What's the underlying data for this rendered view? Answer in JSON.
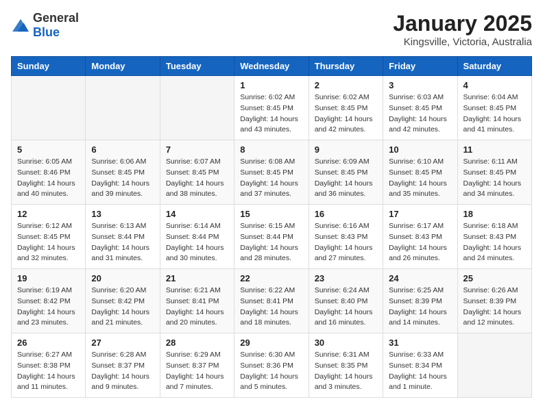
{
  "logo": {
    "general": "General",
    "blue": "Blue"
  },
  "title": "January 2025",
  "subtitle": "Kingsville, Victoria, Australia",
  "weekdays": [
    "Sunday",
    "Monday",
    "Tuesday",
    "Wednesday",
    "Thursday",
    "Friday",
    "Saturday"
  ],
  "weeks": [
    [
      {
        "day": "",
        "sunrise": "",
        "sunset": "",
        "daylight": ""
      },
      {
        "day": "",
        "sunrise": "",
        "sunset": "",
        "daylight": ""
      },
      {
        "day": "",
        "sunrise": "",
        "sunset": "",
        "daylight": ""
      },
      {
        "day": "1",
        "sunrise": "Sunrise: 6:02 AM",
        "sunset": "Sunset: 8:45 PM",
        "daylight": "Daylight: 14 hours and 43 minutes."
      },
      {
        "day": "2",
        "sunrise": "Sunrise: 6:02 AM",
        "sunset": "Sunset: 8:45 PM",
        "daylight": "Daylight: 14 hours and 42 minutes."
      },
      {
        "day": "3",
        "sunrise": "Sunrise: 6:03 AM",
        "sunset": "Sunset: 8:45 PM",
        "daylight": "Daylight: 14 hours and 42 minutes."
      },
      {
        "day": "4",
        "sunrise": "Sunrise: 6:04 AM",
        "sunset": "Sunset: 8:45 PM",
        "daylight": "Daylight: 14 hours and 41 minutes."
      }
    ],
    [
      {
        "day": "5",
        "sunrise": "Sunrise: 6:05 AM",
        "sunset": "Sunset: 8:46 PM",
        "daylight": "Daylight: 14 hours and 40 minutes."
      },
      {
        "day": "6",
        "sunrise": "Sunrise: 6:06 AM",
        "sunset": "Sunset: 8:45 PM",
        "daylight": "Daylight: 14 hours and 39 minutes."
      },
      {
        "day": "7",
        "sunrise": "Sunrise: 6:07 AM",
        "sunset": "Sunset: 8:45 PM",
        "daylight": "Daylight: 14 hours and 38 minutes."
      },
      {
        "day": "8",
        "sunrise": "Sunrise: 6:08 AM",
        "sunset": "Sunset: 8:45 PM",
        "daylight": "Daylight: 14 hours and 37 minutes."
      },
      {
        "day": "9",
        "sunrise": "Sunrise: 6:09 AM",
        "sunset": "Sunset: 8:45 PM",
        "daylight": "Daylight: 14 hours and 36 minutes."
      },
      {
        "day": "10",
        "sunrise": "Sunrise: 6:10 AM",
        "sunset": "Sunset: 8:45 PM",
        "daylight": "Daylight: 14 hours and 35 minutes."
      },
      {
        "day": "11",
        "sunrise": "Sunrise: 6:11 AM",
        "sunset": "Sunset: 8:45 PM",
        "daylight": "Daylight: 14 hours and 34 minutes."
      }
    ],
    [
      {
        "day": "12",
        "sunrise": "Sunrise: 6:12 AM",
        "sunset": "Sunset: 8:45 PM",
        "daylight": "Daylight: 14 hours and 32 minutes."
      },
      {
        "day": "13",
        "sunrise": "Sunrise: 6:13 AM",
        "sunset": "Sunset: 8:44 PM",
        "daylight": "Daylight: 14 hours and 31 minutes."
      },
      {
        "day": "14",
        "sunrise": "Sunrise: 6:14 AM",
        "sunset": "Sunset: 8:44 PM",
        "daylight": "Daylight: 14 hours and 30 minutes."
      },
      {
        "day": "15",
        "sunrise": "Sunrise: 6:15 AM",
        "sunset": "Sunset: 8:44 PM",
        "daylight": "Daylight: 14 hours and 28 minutes."
      },
      {
        "day": "16",
        "sunrise": "Sunrise: 6:16 AM",
        "sunset": "Sunset: 8:43 PM",
        "daylight": "Daylight: 14 hours and 27 minutes."
      },
      {
        "day": "17",
        "sunrise": "Sunrise: 6:17 AM",
        "sunset": "Sunset: 8:43 PM",
        "daylight": "Daylight: 14 hours and 26 minutes."
      },
      {
        "day": "18",
        "sunrise": "Sunrise: 6:18 AM",
        "sunset": "Sunset: 8:43 PM",
        "daylight": "Daylight: 14 hours and 24 minutes."
      }
    ],
    [
      {
        "day": "19",
        "sunrise": "Sunrise: 6:19 AM",
        "sunset": "Sunset: 8:42 PM",
        "daylight": "Daylight: 14 hours and 23 minutes."
      },
      {
        "day": "20",
        "sunrise": "Sunrise: 6:20 AM",
        "sunset": "Sunset: 8:42 PM",
        "daylight": "Daylight: 14 hours and 21 minutes."
      },
      {
        "day": "21",
        "sunrise": "Sunrise: 6:21 AM",
        "sunset": "Sunset: 8:41 PM",
        "daylight": "Daylight: 14 hours and 20 minutes."
      },
      {
        "day": "22",
        "sunrise": "Sunrise: 6:22 AM",
        "sunset": "Sunset: 8:41 PM",
        "daylight": "Daylight: 14 hours and 18 minutes."
      },
      {
        "day": "23",
        "sunrise": "Sunrise: 6:24 AM",
        "sunset": "Sunset: 8:40 PM",
        "daylight": "Daylight: 14 hours and 16 minutes."
      },
      {
        "day": "24",
        "sunrise": "Sunrise: 6:25 AM",
        "sunset": "Sunset: 8:39 PM",
        "daylight": "Daylight: 14 hours and 14 minutes."
      },
      {
        "day": "25",
        "sunrise": "Sunrise: 6:26 AM",
        "sunset": "Sunset: 8:39 PM",
        "daylight": "Daylight: 14 hours and 12 minutes."
      }
    ],
    [
      {
        "day": "26",
        "sunrise": "Sunrise: 6:27 AM",
        "sunset": "Sunset: 8:38 PM",
        "daylight": "Daylight: 14 hours and 11 minutes."
      },
      {
        "day": "27",
        "sunrise": "Sunrise: 6:28 AM",
        "sunset": "Sunset: 8:37 PM",
        "daylight": "Daylight: 14 hours and 9 minutes."
      },
      {
        "day": "28",
        "sunrise": "Sunrise: 6:29 AM",
        "sunset": "Sunset: 8:37 PM",
        "daylight": "Daylight: 14 hours and 7 minutes."
      },
      {
        "day": "29",
        "sunrise": "Sunrise: 6:30 AM",
        "sunset": "Sunset: 8:36 PM",
        "daylight": "Daylight: 14 hours and 5 minutes."
      },
      {
        "day": "30",
        "sunrise": "Sunrise: 6:31 AM",
        "sunset": "Sunset: 8:35 PM",
        "daylight": "Daylight: 14 hours and 3 minutes."
      },
      {
        "day": "31",
        "sunrise": "Sunrise: 6:33 AM",
        "sunset": "Sunset: 8:34 PM",
        "daylight": "Daylight: 14 hours and 1 minute."
      },
      {
        "day": "",
        "sunrise": "",
        "sunset": "",
        "daylight": ""
      }
    ]
  ]
}
